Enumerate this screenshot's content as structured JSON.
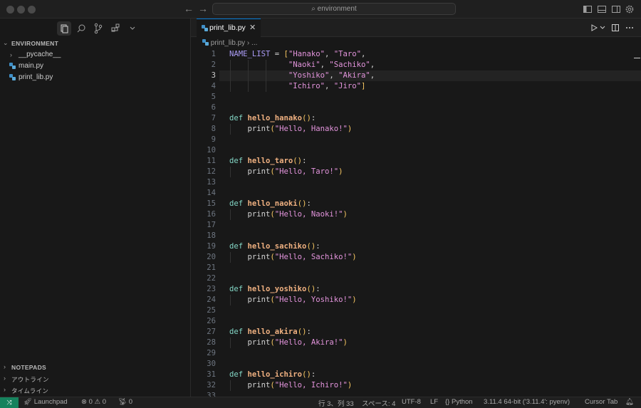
{
  "title": {
    "search_text": "environment"
  },
  "sidebar": {
    "section_title": "ENVIRONMENT",
    "items": [
      {
        "label": "__pycache__",
        "type": "folder"
      },
      {
        "label": "main.py",
        "type": "python-file"
      },
      {
        "label": "print_lib.py",
        "type": "python-file"
      }
    ],
    "bottom_sections": [
      "NOTEPADS",
      "アウトライン",
      "タイムライン"
    ]
  },
  "editor": {
    "tab_label": "print_lib.py",
    "breadcrumb_file": "print_lib.py",
    "breadcrumb_sep": "›",
    "breadcrumb_more": "...",
    "current_line": 3
  },
  "code_lines": [
    [
      [
        "var",
        "NAME_LIST"
      ],
      [
        "p",
        " = "
      ],
      [
        "br",
        "["
      ],
      [
        "str",
        "\"Hanako\""
      ],
      [
        "p",
        ", "
      ],
      [
        "str",
        "\"Taro\""
      ],
      [
        "p",
        ","
      ]
    ],
    [
      [
        "p",
        "             "
      ],
      [
        "str",
        "\"Naoki\""
      ],
      [
        "p",
        ", "
      ],
      [
        "str",
        "\"Sachiko\""
      ],
      [
        "p",
        ","
      ]
    ],
    [
      [
        "p",
        "             "
      ],
      [
        "str",
        "\"Yoshiko\""
      ],
      [
        "p",
        ", "
      ],
      [
        "str",
        "\"Akira\""
      ],
      [
        "p",
        ","
      ]
    ],
    [
      [
        "p",
        "             "
      ],
      [
        "str",
        "\"Ichiro\""
      ],
      [
        "p",
        ", "
      ],
      [
        "str",
        "\"Jiro\""
      ],
      [
        "br",
        "]"
      ]
    ],
    [],
    [],
    [
      [
        "kw",
        "def "
      ],
      [
        "fn",
        "hello_hanako"
      ],
      [
        "br",
        "()"
      ],
      [
        "p",
        ":"
      ]
    ],
    [
      [
        "p",
        "    print"
      ],
      [
        "br",
        "("
      ],
      [
        "str",
        "\"Hello, Hanako!\""
      ],
      [
        "br",
        ")"
      ]
    ],
    [],
    [],
    [
      [
        "kw",
        "def "
      ],
      [
        "fn",
        "hello_taro"
      ],
      [
        "br",
        "()"
      ],
      [
        "p",
        ":"
      ]
    ],
    [
      [
        "p",
        "    print"
      ],
      [
        "br",
        "("
      ],
      [
        "str",
        "\"Hello, Taro!\""
      ],
      [
        "br",
        ")"
      ]
    ],
    [],
    [],
    [
      [
        "kw",
        "def "
      ],
      [
        "fn",
        "hello_naoki"
      ],
      [
        "br",
        "()"
      ],
      [
        "p",
        ":"
      ]
    ],
    [
      [
        "p",
        "    print"
      ],
      [
        "br",
        "("
      ],
      [
        "str",
        "\"Hello, Naoki!\""
      ],
      [
        "br",
        ")"
      ]
    ],
    [],
    [],
    [
      [
        "kw",
        "def "
      ],
      [
        "fn",
        "hello_sachiko"
      ],
      [
        "br",
        "()"
      ],
      [
        "p",
        ":"
      ]
    ],
    [
      [
        "p",
        "    print"
      ],
      [
        "br",
        "("
      ],
      [
        "str",
        "\"Hello, Sachiko!\""
      ],
      [
        "br",
        ")"
      ]
    ],
    [],
    [],
    [
      [
        "kw",
        "def "
      ],
      [
        "fn",
        "hello_yoshiko"
      ],
      [
        "br",
        "()"
      ],
      [
        "p",
        ":"
      ]
    ],
    [
      [
        "p",
        "    print"
      ],
      [
        "br",
        "("
      ],
      [
        "str",
        "\"Hello, Yoshiko!\""
      ],
      [
        "br",
        ")"
      ]
    ],
    [],
    [],
    [
      [
        "kw",
        "def "
      ],
      [
        "fn",
        "hello_akira"
      ],
      [
        "br",
        "()"
      ],
      [
        "p",
        ":"
      ]
    ],
    [
      [
        "p",
        "    print"
      ],
      [
        "br",
        "("
      ],
      [
        "str",
        "\"Hello, Akira!\""
      ],
      [
        "br",
        ")"
      ]
    ],
    [],
    [],
    [
      [
        "kw",
        "def "
      ],
      [
        "fn",
        "hello_ichiro"
      ],
      [
        "br",
        "()"
      ],
      [
        "p",
        ":"
      ]
    ],
    [
      [
        "p",
        "    print"
      ],
      [
        "br",
        "("
      ],
      [
        "str",
        "\"Hello, Ichiro!\""
      ],
      [
        "br",
        ")"
      ]
    ],
    []
  ],
  "status": {
    "launchpad": "Launchpad",
    "errors": "0",
    "warnings": "0",
    "ports": "0",
    "position": "行 3、列 33",
    "spaces": "スペース: 4",
    "encoding": "UTF-8",
    "eol": "LF",
    "language": "Python",
    "interpreter": "3.11.4 64-bit ('3.11.4': pyenv)",
    "cursor_tab": "Cursor Tab"
  },
  "colors": {
    "accent": "#0078d4",
    "remote": "#16825d",
    "string": "#e394dc",
    "keyword": "#83d6c5",
    "function": "#efb080"
  }
}
